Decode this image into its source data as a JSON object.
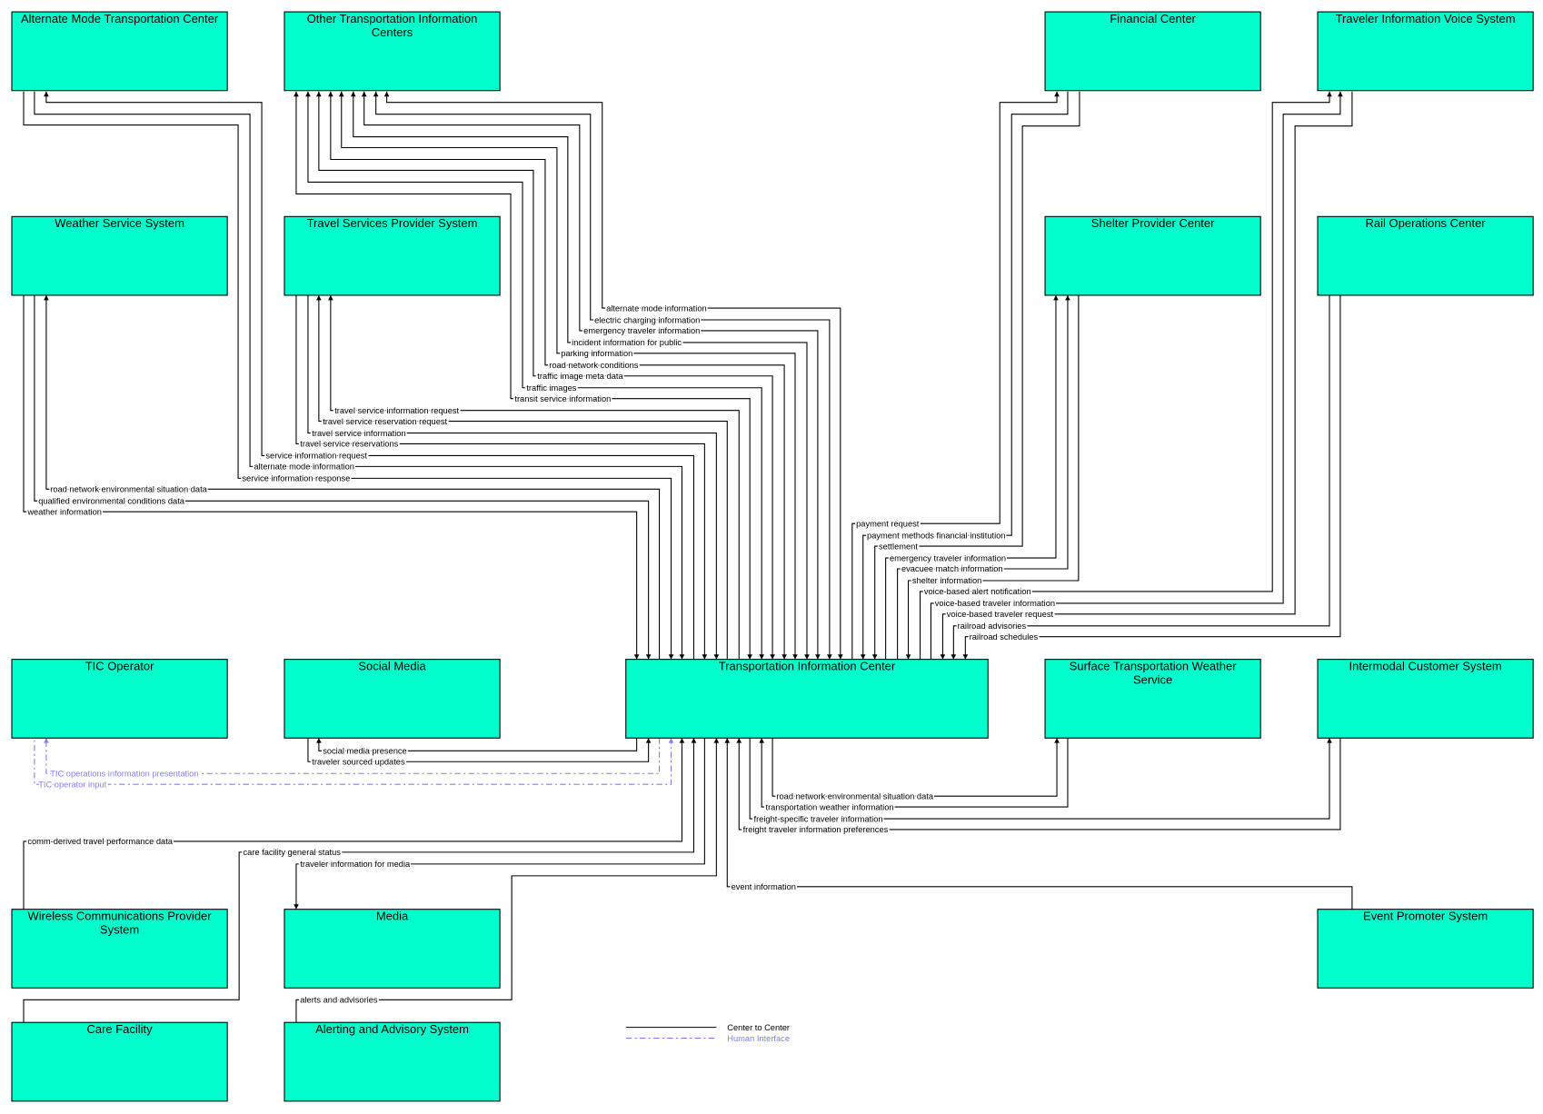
{
  "colors": {
    "entity_fill": "#00ffcc",
    "center_to_center": "#000000",
    "human_interface": "#8080ff"
  },
  "entities": {
    "amtc": "Alternate Mode Transportation Center",
    "otic": "Other Transportation Information Centers",
    "fc": "Financial Center",
    "tivs": "Traveler Information Voice System",
    "wss": "Weather Service System",
    "tsp": "Travel Services Provider System",
    "spc": "Shelter Provider Center",
    "roc": "Rail Operations Center",
    "ticop": "TIC Operator",
    "sm": "Social Media",
    "tic": "Transportation Information Center",
    "stws": "Surface Transportation Weather Service",
    "ics": "Intermodal Customer System",
    "wcp": "Wireless Communications  Provider System",
    "media": "Media",
    "eps": "Event Promoter System",
    "cf": "Care Facility",
    "aas": "Alerting and Advisory System"
  },
  "flows": [
    {
      "label": "weather information",
      "other": "wss",
      "direction": "to-tic",
      "type": "center"
    },
    {
      "label": "qualified environmental conditions data",
      "other": "wss",
      "direction": "to-tic",
      "type": "center"
    },
    {
      "label": "road network environmental situation data",
      "other": "wss",
      "direction": "from-tic",
      "type": "center"
    },
    {
      "label": "service information response",
      "other": "amtc",
      "direction": "to-tic",
      "type": "center"
    },
    {
      "label": "alternate mode information",
      "other": "amtc",
      "direction": "to-tic",
      "type": "center"
    },
    {
      "label": "service information request",
      "other": "amtc",
      "direction": "from-tic",
      "type": "center"
    },
    {
      "label": "travel service reservations",
      "other": "tsp",
      "direction": "to-tic",
      "type": "center"
    },
    {
      "label": "travel service information",
      "other": "tsp",
      "direction": "to-tic",
      "type": "center"
    },
    {
      "label": "travel service reservation request",
      "other": "tsp",
      "direction": "from-tic",
      "type": "center"
    },
    {
      "label": "travel service information request",
      "other": "tsp",
      "direction": "from-tic",
      "type": "center"
    },
    {
      "label": "transit service information",
      "other": "otic",
      "direction": "bidirectional",
      "type": "center"
    },
    {
      "label": "traffic images",
      "other": "otic",
      "direction": "bidirectional",
      "type": "center"
    },
    {
      "label": "traffic image meta data",
      "other": "otic",
      "direction": "bidirectional",
      "type": "center"
    },
    {
      "label": "road network conditions",
      "other": "otic",
      "direction": "bidirectional",
      "type": "center"
    },
    {
      "label": "parking information",
      "other": "otic",
      "direction": "bidirectional",
      "type": "center"
    },
    {
      "label": "incident information for public",
      "other": "otic",
      "direction": "bidirectional",
      "type": "center"
    },
    {
      "label": "emergency traveler information",
      "other": "otic",
      "direction": "bidirectional",
      "type": "center"
    },
    {
      "label": "electric charging information",
      "other": "otic",
      "direction": "bidirectional",
      "type": "center"
    },
    {
      "label": "alternate mode information",
      "other": "otic",
      "direction": "bidirectional",
      "type": "center"
    },
    {
      "label": "payment request",
      "other": "fc",
      "direction": "from-tic",
      "type": "center"
    },
    {
      "label": "payment methods financial institution",
      "other": "fc",
      "direction": "to-tic",
      "type": "center"
    },
    {
      "label": "settlement",
      "other": "fc",
      "direction": "to-tic",
      "type": "center"
    },
    {
      "label": "emergency traveler information",
      "other": "spc",
      "direction": "from-tic",
      "type": "center"
    },
    {
      "label": "evacuee match information",
      "other": "spc",
      "direction": "from-tic",
      "type": "center"
    },
    {
      "label": "shelter information",
      "other": "spc",
      "direction": "to-tic",
      "type": "center"
    },
    {
      "label": "voice-based alert notification",
      "other": "tivs",
      "direction": "from-tic",
      "type": "center"
    },
    {
      "label": "voice-based traveler information",
      "other": "tivs",
      "direction": "from-tic",
      "type": "center"
    },
    {
      "label": "voice-based traveler request",
      "other": "tivs",
      "direction": "to-tic",
      "type": "center"
    },
    {
      "label": "railroad advisories",
      "other": "roc",
      "direction": "to-tic",
      "type": "center"
    },
    {
      "label": "railroad schedules",
      "other": "roc",
      "direction": "to-tic",
      "type": "center"
    },
    {
      "label": "social media presence",
      "other": "sm",
      "direction": "from-tic",
      "type": "center"
    },
    {
      "label": "traveler sourced updates",
      "other": "sm",
      "direction": "to-tic",
      "type": "center"
    },
    {
      "label": "TIC operations information presentation",
      "other": "ticop",
      "direction": "from-tic",
      "type": "human"
    },
    {
      "label": "TIC operator input",
      "other": "ticop",
      "direction": "to-tic",
      "type": "human"
    },
    {
      "label": "comm-derived travel performance data",
      "other": "wcp",
      "direction": "to-tic",
      "type": "center"
    },
    {
      "label": "care facility general status",
      "other": "cf",
      "direction": "to-tic",
      "type": "center"
    },
    {
      "label": "traveler information for media",
      "other": "media",
      "direction": "from-tic",
      "type": "center"
    },
    {
      "label": "alerts and advisories",
      "other": "aas",
      "direction": "to-tic",
      "type": "center"
    },
    {
      "label": "event information",
      "other": "eps",
      "direction": "to-tic",
      "type": "center"
    },
    {
      "label": "freight traveler information preferences",
      "other": "ics",
      "direction": "to-tic",
      "type": "center"
    },
    {
      "label": "freight-specific traveler information",
      "other": "ics",
      "direction": "from-tic",
      "type": "center"
    },
    {
      "label": "transportation weather information",
      "other": "stws",
      "direction": "to-tic",
      "type": "center"
    },
    {
      "label": "road network environmental situation data",
      "other": "stws",
      "direction": "from-tic",
      "type": "center"
    }
  ],
  "legend": {
    "center_to_center": "Center to Center",
    "human_interface": "Human Interface"
  }
}
